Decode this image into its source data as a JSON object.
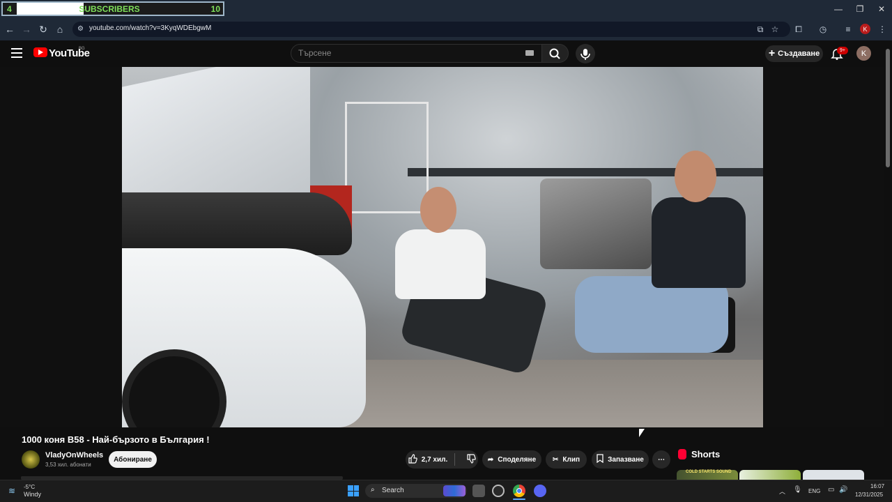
{
  "overlay": {
    "left_count": "4",
    "label": "SUBSCRIBERS",
    "right_count": "10"
  },
  "window_controls": {
    "minimize_icon": "minimize-icon",
    "restore_icon": "restore-icon",
    "close_icon": "close-icon"
  },
  "browser": {
    "url": "youtube.com/watch?v=3KyqWDEbgwM",
    "profile_initial": "K"
  },
  "youtube": {
    "logo_text": "YouTube",
    "country": "BG",
    "search_placeholder": "Търсене",
    "create_label": "Създаване",
    "notification_badge": "9+",
    "avatar_initial": "K"
  },
  "video": {
    "title": "1000 коня B58 - Най-бързото в България !",
    "channel": "VladyOnWheels",
    "subscribers": "3,53 хил. абонати",
    "subscribe_label": "Абониране",
    "likes": "2,7 хил.",
    "share_label": "Споделяне",
    "clip_label": "Клип",
    "save_label": "Запазване",
    "more_label": "⋯"
  },
  "shorts": {
    "label": "Shorts",
    "thumb1_text": "COLD STARTS SOUND"
  },
  "taskbar": {
    "weather_temp": "-5°C",
    "weather_desc": "Windy",
    "search_label": "Search",
    "language": "ENG",
    "time": "16:07",
    "date": "12/31/2025"
  },
  "colors": {
    "yt_red": "#ff0000",
    "page_bg": "#0f0f0f",
    "overlay_green": "#7ee05a"
  }
}
